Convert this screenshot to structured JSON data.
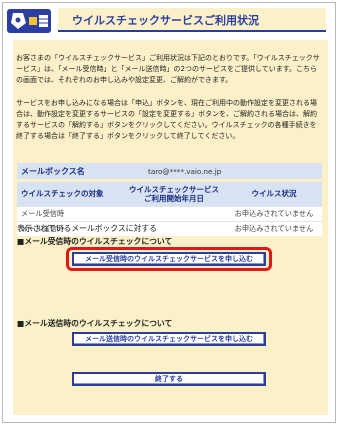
{
  "header": {
    "title": "ウイルスチェックサービスご利用状況"
  },
  "intro": {
    "paragraph1": "お客さまの「ウイルスチェックサービス」ご利用状況は下記のとおりです。「ウイルスチェックサービス」は、「メール受信時」と「メール送信時」の2つのサービスをご提供しています。こちらの画面では、それぞれのお申し込みや設定変更、ご解約ができます。",
    "paragraph2": "サービスをお申し込みになる場合は「申込」ボタンを、現在ご利用中の動作設定を変更される場合は、動作設定を変更するサービスの「設定を変更する」ボタンを、ご解約される場合は、解約するサービスの「解約する」ボタンをクリックしてください。ウイルスチェックの各種手続きを終了する場合は「終了する」ボタンをクリックして終了してください。"
  },
  "mailbox": {
    "label": "メールボックス名",
    "value": "taro@****.vaio.ne.jp"
  },
  "table": {
    "col1": "ウイルスチェックの対象",
    "col2_line1": "ウイルスチェックサービス",
    "col2_line2": "ご利用開始年月日",
    "col3": "ウイルス状況",
    "rows": [
      {
        "target": "メール受信時",
        "start": "",
        "status": "お申込みされていません"
      },
      {
        "target": "メール送信時",
        "start": "",
        "status": "お申込みされていません"
      }
    ]
  },
  "section": {
    "heading": "表示されているメールボックスに対する",
    "receive_title": "■メール受信時のウイルスチェックについて",
    "send_title": "■メール送信時のウイルスチェックについて"
  },
  "buttons": {
    "receive_apply": "メール受信時のウイルスチェックサービスを申し込む",
    "send_apply": "メール送信時のウイルスチェックサービスを申し込む",
    "finish": "終了する"
  },
  "colors": {
    "panel": "#fbf0c8",
    "accent": "#2b3fa3",
    "highlight": "#e01818"
  }
}
